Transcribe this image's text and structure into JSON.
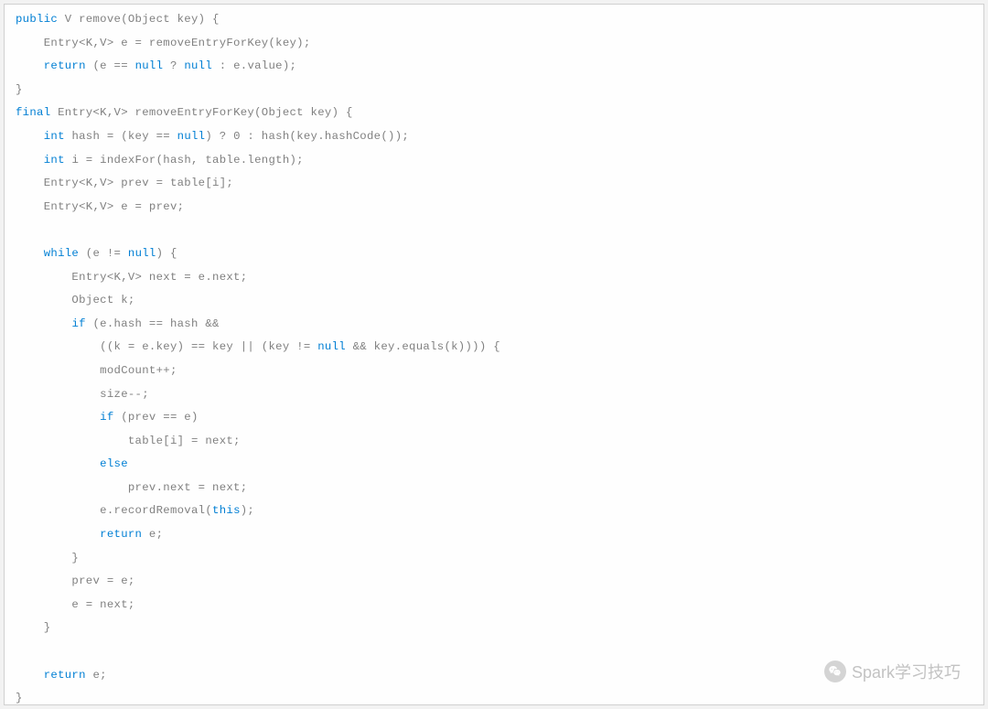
{
  "code": {
    "l1_kw": "public",
    "l1_rest": " V remove(Object key) {",
    "l2": "    Entry<K,V> e = removeEntryForKey(key);",
    "l3_a": "    ",
    "l3_kw1": "return",
    "l3_b": " (e == ",
    "l3_kw2": "null",
    "l3_c": " ? ",
    "l3_kw3": "null",
    "l3_d": " : e.value);",
    "l4": "}",
    "l5_kw": "final",
    "l5_rest": " Entry<K,V> removeEntryForKey(Object key) {",
    "l6_a": "    ",
    "l6_kw1": "int",
    "l6_b": " hash = (key == ",
    "l6_kw2": "null",
    "l6_c": ") ? 0 : hash(key.hashCode());",
    "l7_a": "    ",
    "l7_kw": "int",
    "l7_b": " i = indexFor(hash, table.length);",
    "l8": "    Entry<K,V> prev = table[i];",
    "l9": "    Entry<K,V> e = prev;",
    "l10": " ",
    "l11_a": "    ",
    "l11_kw1": "while",
    "l11_b": " (e != ",
    "l11_kw2": "null",
    "l11_c": ") {",
    "l12": "        Entry<K,V> next = e.next;",
    "l13": "        Object k;",
    "l14_a": "        ",
    "l14_kw": "if",
    "l14_b": " (e.hash == hash &&",
    "l15_a": "            ((k = e.key) == key || (key != ",
    "l15_kw": "null",
    "l15_b": " && key.equals(k)))) {",
    "l16": "            modCount++;",
    "l17": "            size--;",
    "l18_a": "            ",
    "l18_kw": "if",
    "l18_b": " (prev == e)",
    "l19": "                table[i] = next;",
    "l20_a": "            ",
    "l20_kw": "else",
    "l21": "                prev.next = next;",
    "l22_a": "            e.recordRemoval(",
    "l22_kw": "this",
    "l22_b": ");",
    "l23_a": "            ",
    "l23_kw": "return",
    "l23_b": " e;",
    "l24": "        }",
    "l25": "        prev = e;",
    "l26": "        e = next;",
    "l27": "    }",
    "l28": " ",
    "l29_a": "    ",
    "l29_kw": "return",
    "l29_b": " e;",
    "l30": "}"
  },
  "watermark": {
    "text": "Spark学习技巧"
  }
}
